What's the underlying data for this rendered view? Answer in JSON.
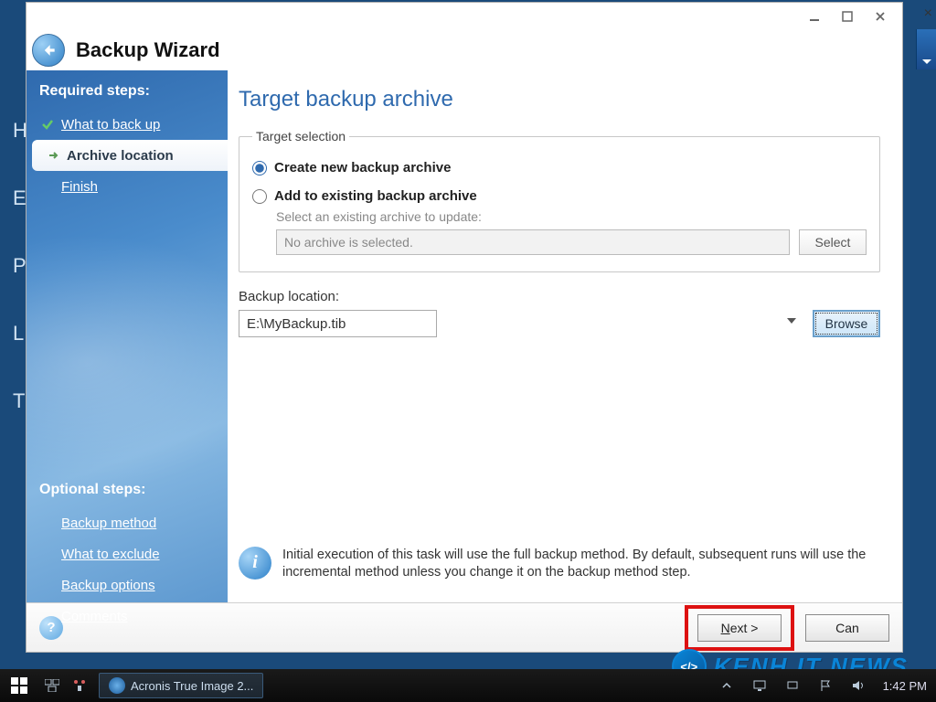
{
  "window": {
    "title": "Backup Wizard"
  },
  "sidebar": {
    "required_head": "Required steps:",
    "optional_head": "Optional steps:",
    "required": [
      {
        "label": "What to back up"
      },
      {
        "label": "Archive location"
      },
      {
        "label": "Finish"
      }
    ],
    "optional": [
      {
        "label": "Backup method"
      },
      {
        "label": "What to exclude"
      },
      {
        "label": "Backup options"
      },
      {
        "label": "Comments"
      }
    ]
  },
  "page": {
    "title": "Target backup archive",
    "group_legend": "Target selection",
    "radio_create": "Create new backup archive",
    "radio_add": "Add to existing backup archive",
    "add_hint": "Select an existing archive to update:",
    "archive_placeholder": "No archive is selected.",
    "select_btn": "Select",
    "location_label": "Backup location:",
    "location_value": "E:\\MyBackup.tib",
    "browse_btn": "Browse",
    "info_text": "Initial execution of this task will use the full backup method. By default, subsequent runs will use the incremental method unless you change it on the backup method step."
  },
  "footer": {
    "next": "Next >",
    "cancel": "Cancel"
  },
  "taskbar": {
    "app": "Acronis True Image 2...",
    "clock": "1:42 PM"
  },
  "watermark": "KENH IT NEWS",
  "bg_letters": [
    "H",
    "E",
    "P",
    "L",
    "T"
  ]
}
